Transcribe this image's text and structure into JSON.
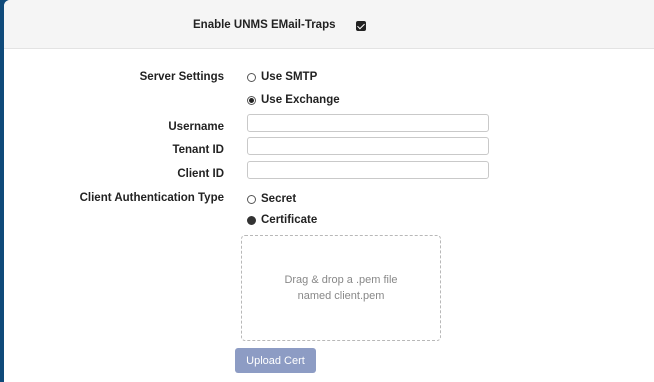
{
  "email_traps": {
    "label": "Enable UNMS EMail-Traps",
    "checked": true
  },
  "server_settings": {
    "label": "Server Settings",
    "options": [
      {
        "label": "Use SMTP",
        "selected": false
      },
      {
        "label": "Use Exchange",
        "selected": true
      }
    ]
  },
  "fields": {
    "username": {
      "label": "Username",
      "value": ""
    },
    "tenant_id": {
      "label": "Tenant ID",
      "value": ""
    },
    "client_id": {
      "label": "Client ID",
      "value": ""
    }
  },
  "client_auth": {
    "label": "Client Authentication Type",
    "options": [
      {
        "label": "Secret",
        "selected": false
      },
      {
        "label": "Certificate",
        "selected": true
      }
    ]
  },
  "dropzone": {
    "text": "Drag & drop a .pem file named client.pem"
  },
  "upload_button": {
    "label": "Upload Cert",
    "color": "#8d9cc4"
  },
  "colors": {
    "background": "#0f4a7a",
    "panel": "#ffffff",
    "header": "#f5f5f5"
  }
}
